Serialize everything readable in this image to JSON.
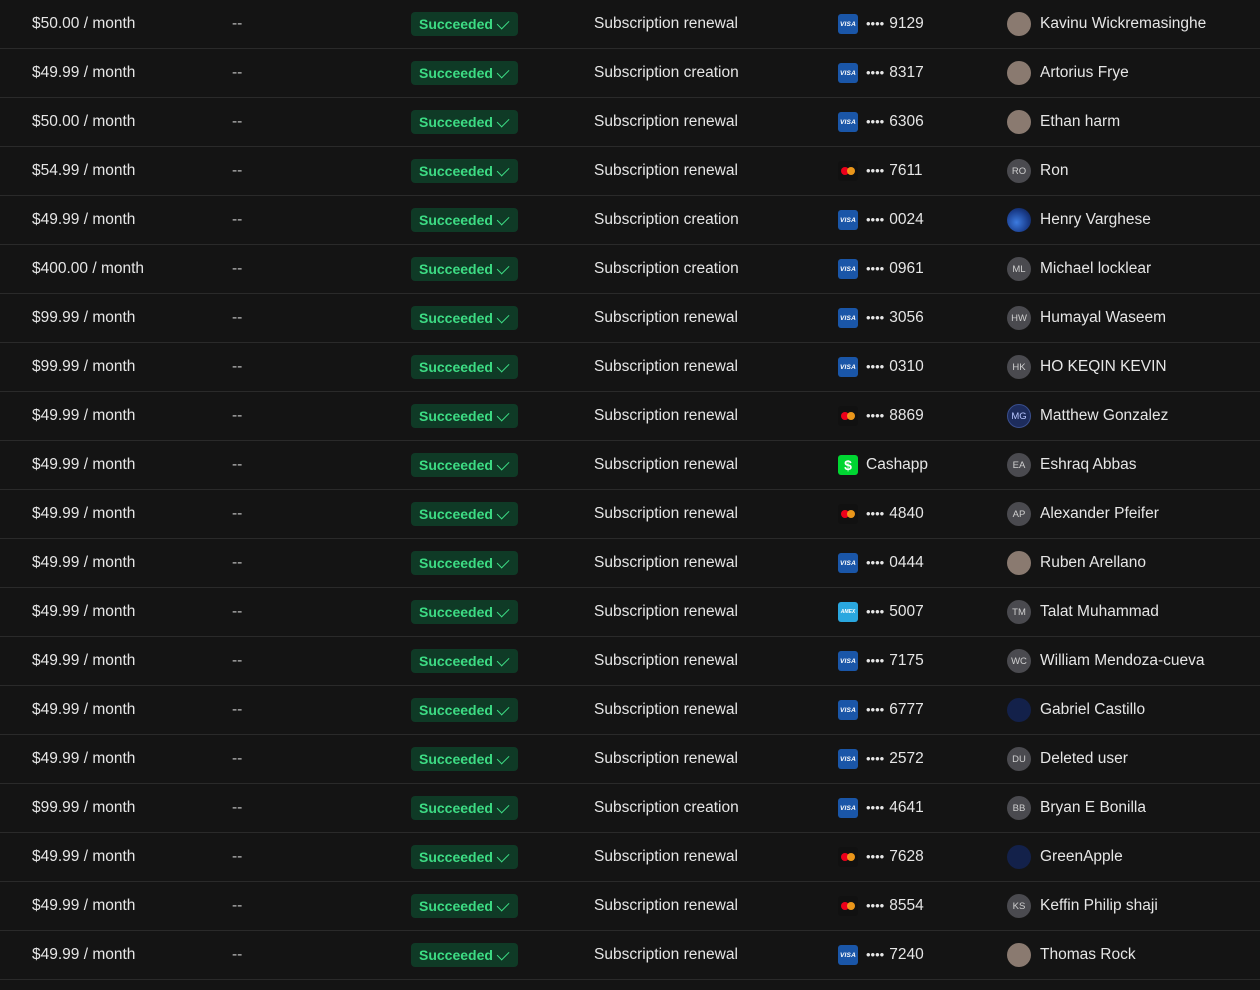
{
  "status_label": "Succeeded",
  "rows": [
    {
      "amount": "$50.00 / month",
      "dash": "--",
      "desc": "Subscription renewal",
      "brand": "visa",
      "last4": "9129",
      "pay_text": "",
      "avatar_type": "photo",
      "initials": "",
      "customer": "Kavinu Wickremasinghe"
    },
    {
      "amount": "$49.99 / month",
      "dash": "--",
      "desc": "Subscription creation",
      "brand": "visa",
      "last4": "8317",
      "pay_text": "",
      "avatar_type": "photo",
      "initials": "",
      "customer": "Artorius Frye"
    },
    {
      "amount": "$50.00 / month",
      "dash": "--",
      "desc": "Subscription renewal",
      "brand": "visa",
      "last4": "6306",
      "pay_text": "",
      "avatar_type": "photo",
      "initials": "",
      "customer": "Ethan harm"
    },
    {
      "amount": "$54.99 / month",
      "dash": "--",
      "desc": "Subscription renewal",
      "brand": "mastercard",
      "last4": "7611",
      "pay_text": "",
      "avatar_type": "initials",
      "initials": "RO",
      "customer": "Ron"
    },
    {
      "amount": "$49.99 / month",
      "dash": "--",
      "desc": "Subscription creation",
      "brand": "visa",
      "last4": "0024",
      "pay_text": "",
      "avatar_type": "blue-earth",
      "initials": "",
      "customer": "Henry Varghese"
    },
    {
      "amount": "$400.00 / month",
      "dash": "--",
      "desc": "Subscription creation",
      "brand": "visa",
      "last4": "0961",
      "pay_text": "",
      "avatar_type": "initials",
      "initials": "ML",
      "customer": "Michael locklear"
    },
    {
      "amount": "$99.99 / month",
      "dash": "--",
      "desc": "Subscription renewal",
      "brand": "visa",
      "last4": "3056",
      "pay_text": "",
      "avatar_type": "initials",
      "initials": "HW",
      "customer": "Humayal Waseem"
    },
    {
      "amount": "$99.99 / month",
      "dash": "--",
      "desc": "Subscription renewal",
      "brand": "visa",
      "last4": "0310",
      "pay_text": "",
      "avatar_type": "initials",
      "initials": "HK",
      "customer": "HO KEQIN KEVIN"
    },
    {
      "amount": "$49.99 / month",
      "dash": "--",
      "desc": "Subscription renewal",
      "brand": "mastercard",
      "last4": "8869",
      "pay_text": "",
      "avatar_type": "mg",
      "initials": "MG",
      "customer": "Matthew Gonzalez"
    },
    {
      "amount": "$49.99 / month",
      "dash": "--",
      "desc": "Subscription renewal",
      "brand": "cashapp",
      "last4": "",
      "pay_text": "Cashapp",
      "avatar_type": "initials",
      "initials": "EA",
      "customer": "Eshraq Abbas"
    },
    {
      "amount": "$49.99 / month",
      "dash": "--",
      "desc": "Subscription renewal",
      "brand": "mastercard",
      "last4": "4840",
      "pay_text": "",
      "avatar_type": "initials",
      "initials": "AP",
      "customer": "Alexander Pfeifer"
    },
    {
      "amount": "$49.99 / month",
      "dash": "--",
      "desc": "Subscription renewal",
      "brand": "visa",
      "last4": "0444",
      "pay_text": "",
      "avatar_type": "photo",
      "initials": "",
      "customer": "Ruben Arellano"
    },
    {
      "amount": "$49.99 / month",
      "dash": "--",
      "desc": "Subscription renewal",
      "brand": "amex",
      "last4": "5007",
      "pay_text": "",
      "avatar_type": "initials",
      "initials": "TM",
      "customer": "Talat Muhammad"
    },
    {
      "amount": "$49.99 / month",
      "dash": "--",
      "desc": "Subscription renewal",
      "brand": "visa",
      "last4": "7175",
      "pay_text": "",
      "avatar_type": "initials",
      "initials": "WC",
      "customer": "William Mendoza-cueva"
    },
    {
      "amount": "$49.99 / month",
      "dash": "--",
      "desc": "Subscription renewal",
      "brand": "visa",
      "last4": "6777",
      "pay_text": "",
      "avatar_type": "navy",
      "initials": "",
      "customer": "Gabriel Castillo"
    },
    {
      "amount": "$49.99 / month",
      "dash": "--",
      "desc": "Subscription renewal",
      "brand": "visa",
      "last4": "2572",
      "pay_text": "",
      "avatar_type": "initials",
      "initials": "DU",
      "customer": "Deleted user"
    },
    {
      "amount": "$99.99 / month",
      "dash": "--",
      "desc": "Subscription creation",
      "brand": "visa",
      "last4": "4641",
      "pay_text": "",
      "avatar_type": "initials",
      "initials": "BB",
      "customer": "Bryan E Bonilla"
    },
    {
      "amount": "$49.99 / month",
      "dash": "--",
      "desc": "Subscription renewal",
      "brand": "mastercard",
      "last4": "7628",
      "pay_text": "",
      "avatar_type": "navy",
      "initials": "",
      "customer": "GreenApple"
    },
    {
      "amount": "$49.99 / month",
      "dash": "--",
      "desc": "Subscription renewal",
      "brand": "mastercard",
      "last4": "8554",
      "pay_text": "",
      "avatar_type": "initials",
      "initials": "KS",
      "customer": "Keffin Philip shaji"
    },
    {
      "amount": "$49.99 / month",
      "dash": "--",
      "desc": "Subscription renewal",
      "brand": "visa",
      "last4": "7240",
      "pay_text": "",
      "avatar_type": "photo",
      "initials": "",
      "customer": "Thomas Rock"
    }
  ]
}
